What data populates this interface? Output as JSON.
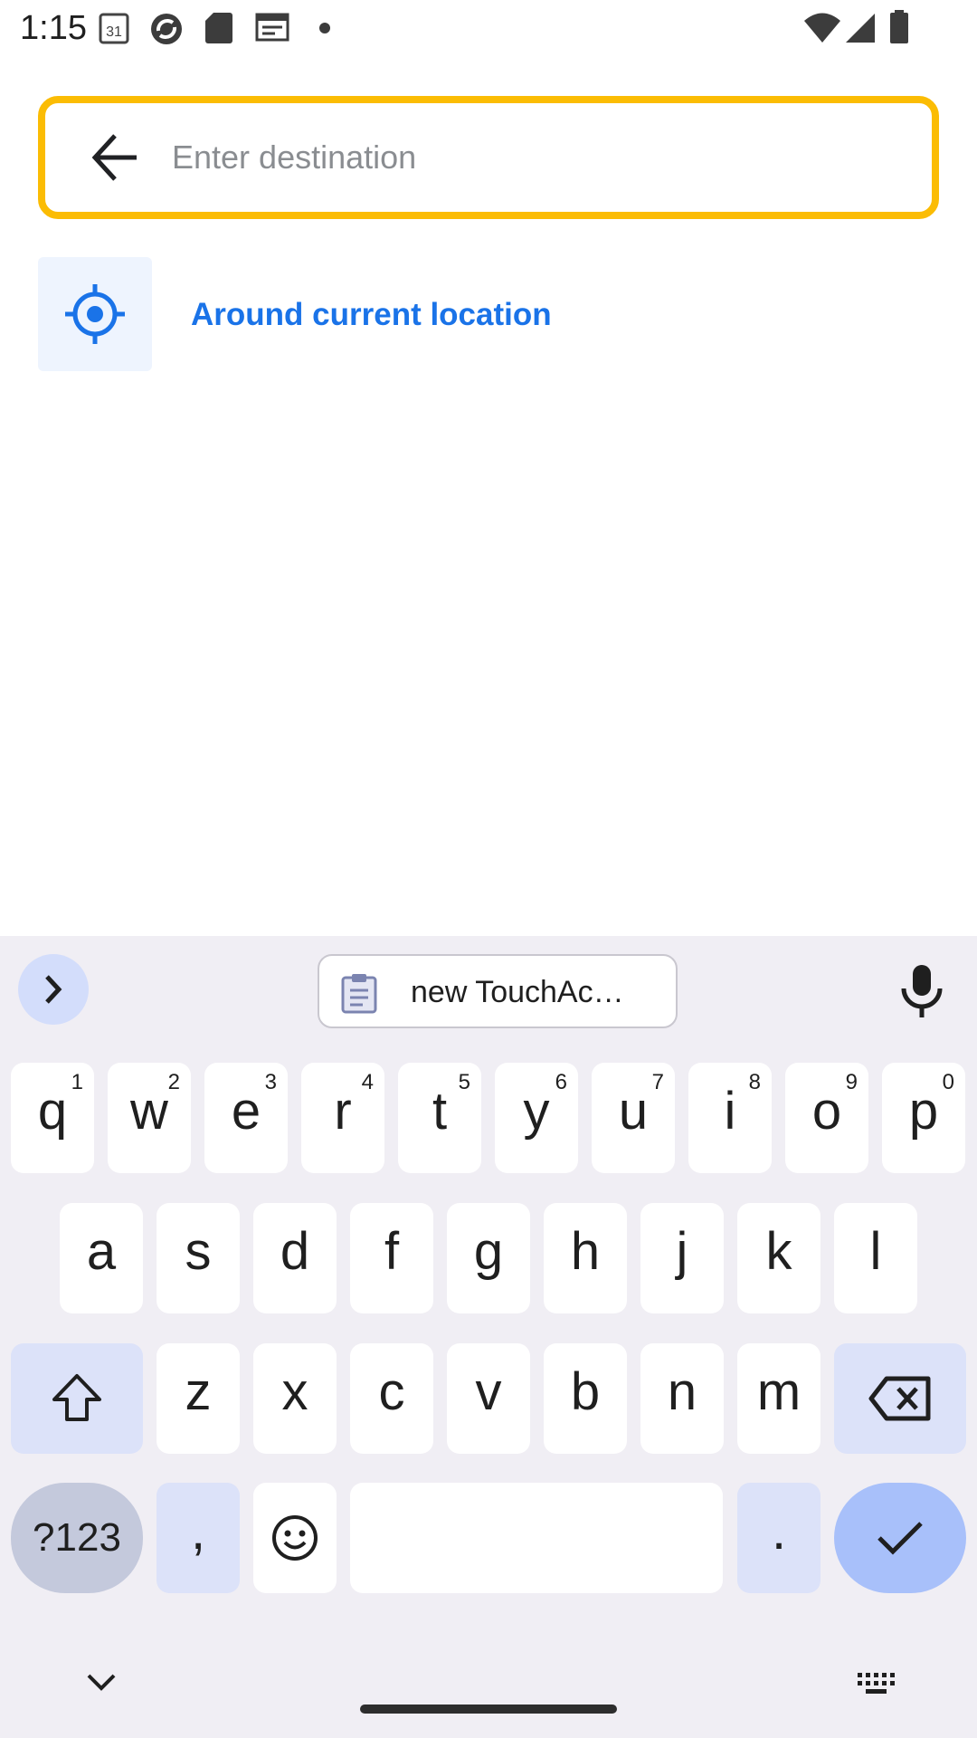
{
  "status_bar": {
    "time": "1:15",
    "icons": [
      "calendar-icon",
      "sync-icon",
      "sd-card-icon",
      "news-icon",
      "dot-icon",
      "wifi-icon",
      "signal-icon",
      "battery-icon"
    ],
    "calendar_day": "31"
  },
  "search": {
    "placeholder": "Enter destination",
    "value": "",
    "border_color": "#fbbc04"
  },
  "suggestions": [
    {
      "label": "Around current location",
      "icon": "my-location-icon",
      "color": "#1a73e8"
    }
  ],
  "keyboard": {
    "clipboard_text": "new TouchAc…",
    "row1": [
      {
        "ch": "q",
        "num": "1"
      },
      {
        "ch": "w",
        "num": "2"
      },
      {
        "ch": "e",
        "num": "3"
      },
      {
        "ch": "r",
        "num": "4"
      },
      {
        "ch": "t",
        "num": "5"
      },
      {
        "ch": "y",
        "num": "6"
      },
      {
        "ch": "u",
        "num": "7"
      },
      {
        "ch": "i",
        "num": "8"
      },
      {
        "ch": "o",
        "num": "9"
      },
      {
        "ch": "p",
        "num": "0"
      }
    ],
    "row2": [
      "a",
      "s",
      "d",
      "f",
      "g",
      "h",
      "j",
      "k",
      "l"
    ],
    "row3": [
      "z",
      "x",
      "c",
      "v",
      "b",
      "n",
      "m"
    ],
    "symbols_label": "?123",
    "comma_label": ",",
    "period_label": "."
  }
}
